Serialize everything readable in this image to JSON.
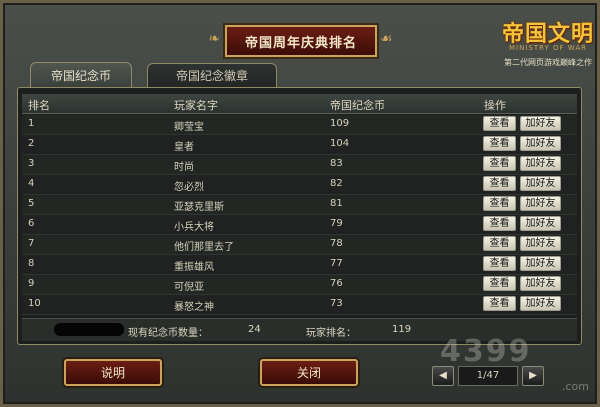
{
  "window": {
    "title": "帝国周年庆典排名"
  },
  "logo": {
    "name": "帝国文明",
    "sub": "MINISTRY OF WAR",
    "tagline": "第二代网页游戏巅峰之作"
  },
  "tabs": [
    {
      "label": "帝国纪念币"
    },
    {
      "label": "帝国纪念徽章"
    }
  ],
  "table": {
    "headers": [
      "排名",
      "玩家名字",
      "帝国纪念币",
      "操作"
    ],
    "rows": [
      {
        "rank": "1",
        "name": "卿莹宝",
        "coins": "109"
      },
      {
        "rank": "2",
        "name": "皇者",
        "coins": "104"
      },
      {
        "rank": "3",
        "name": "时尚",
        "coins": "83"
      },
      {
        "rank": "4",
        "name": "忽必烈",
        "coins": "82"
      },
      {
        "rank": "5",
        "name": "亚瑟克里斯",
        "coins": "81"
      },
      {
        "rank": "6",
        "name": "小兵大将",
        "coins": "79"
      },
      {
        "rank": "7",
        "name": "他们那里去了",
        "coins": "78"
      },
      {
        "rank": "8",
        "name": "重振雄风",
        "coins": "77"
      },
      {
        "rank": "9",
        "name": "可倪亚",
        "coins": "76"
      },
      {
        "rank": "10",
        "name": "暴怒之神",
        "coins": "73"
      }
    ],
    "view_label": "查看",
    "add_friend_label": "加好友"
  },
  "footer": {
    "coins_label": "现有纪念币数量：",
    "coins_value": "24",
    "rank_label": "玩家排名：",
    "rank_value": "119"
  },
  "buttons": {
    "help": "说明",
    "close": "关闭"
  },
  "pager": {
    "prev": "◀",
    "next": "▶",
    "page": "1/47"
  },
  "watermark": {
    "text": "4399",
    "domain": ".com"
  }
}
